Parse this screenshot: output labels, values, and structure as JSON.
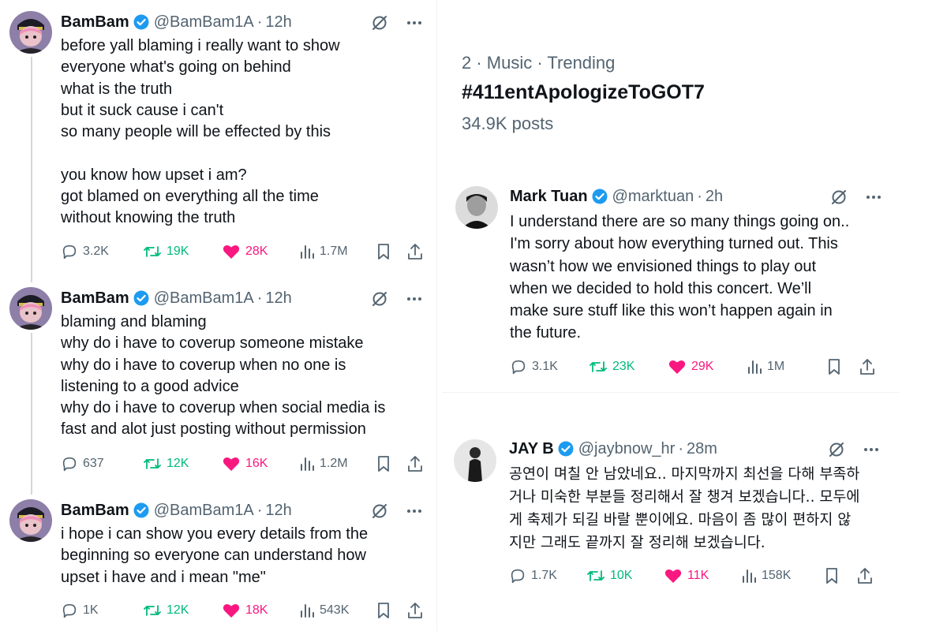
{
  "colors": {
    "text": "#0f1419",
    "secondary": "#536471",
    "verified": "#1d9bf0",
    "retweet": "#00ba7c",
    "like": "#f91880"
  },
  "left_thread": [
    {
      "name": "BamBam",
      "handle": "@BamBam1A",
      "time": "12h",
      "text": "before yall blaming i really want to show\neveryone what's going on behind\nwhat is the truth\nbut it suck cause i can't\nso many people will be effected by this\n\nyou know how upset i am?\ngot blamed on everything all the time\nwithout knowing the truth",
      "replies": "3.2K",
      "retweets": "19K",
      "likes": "28K",
      "views": "1.7M"
    },
    {
      "name": "BamBam",
      "handle": "@BamBam1A",
      "time": "12h",
      "text": "blaming and blaming\nwhy do i have to coverup someone mistake\nwhy do i have to coverup when no one is\nlistening to a good advice\nwhy do i have to coverup when social media is\nfast and alot just posting without permission",
      "replies": "637",
      "retweets": "12K",
      "likes": "16K",
      "views": "1.2M"
    },
    {
      "name": "BamBam",
      "handle": "@BamBam1A",
      "time": "12h",
      "text": "i hope i can show you every details from the\nbeginning so everyone can understand how\nupset i have and i mean \"me\"",
      "replies": "1K",
      "retweets": "12K",
      "likes": "18K",
      "views": "543K"
    }
  ],
  "trend": {
    "meta": "2 · Music · Trending",
    "title": "#411entApologizeToGOT7",
    "posts": "34.9K posts"
  },
  "right_tweets": [
    {
      "name": "Mark Tuan",
      "handle": "@marktuan",
      "time": "2h",
      "text": "I understand there are so many things going on..\nI'm sorry about how everything turned out. This\nwasn’t how we envisioned things to play out\nwhen we decided to hold this concert. We’ll\nmake sure stuff like this won’t happen again in\nthe future.",
      "replies": "3.1K",
      "retweets": "23K",
      "likes": "29K",
      "views": "1M"
    },
    {
      "name": "JAY B",
      "handle": "@jaybnow_hr",
      "time": "28m",
      "text": "공연이 며칠 안 남았네요.. 마지막까지 최선을 다해 부족하\n거나 미숙한 부분들 정리해서 잘 챙겨 보겠습니다.. 모두에\n게 축제가 되길 바랄 뿐이에요. 마음이 좀 많이 편하지 않\n지만 그래도 끝까지 잘 정리해 보겠습니다.",
      "replies": "1.7K",
      "retweets": "10K",
      "likes": "11K",
      "views": "158K"
    }
  ]
}
